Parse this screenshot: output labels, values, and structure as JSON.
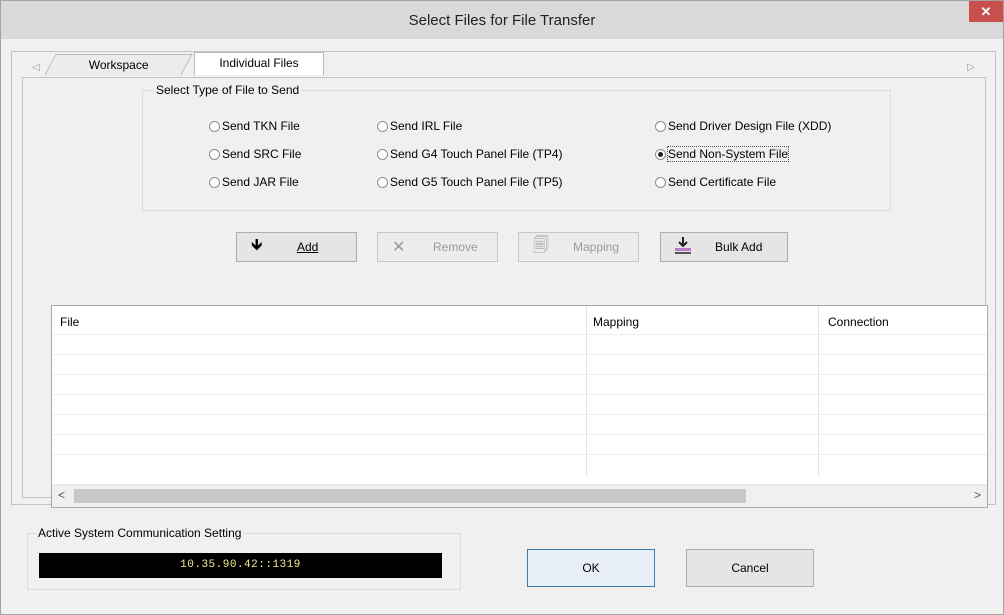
{
  "window": {
    "title": "Select Files for File Transfer",
    "close_label": "✕"
  },
  "tabs": [
    {
      "label": "Workspace"
    },
    {
      "label": "Individual Files"
    }
  ],
  "file_type_group": {
    "title": "Select Type of File to Send",
    "options": [
      {
        "label": "Send TKN File",
        "selected": false
      },
      {
        "label": "Send SRC File",
        "selected": false
      },
      {
        "label": "Send JAR File",
        "selected": false
      },
      {
        "label": "Send IRL File",
        "selected": false
      },
      {
        "label": "Send G4 Touch Panel File (TP4)",
        "selected": false
      },
      {
        "label": "Send G5 Touch Panel File (TP5)",
        "selected": false
      },
      {
        "label": "Send Driver Design File (XDD)",
        "selected": false
      },
      {
        "label": "Send Non-System File",
        "selected": true
      },
      {
        "label": "Send Certificate File",
        "selected": false
      }
    ]
  },
  "toolbar": {
    "add_label": "Add",
    "remove_label": "Remove",
    "mapping_label": "Mapping",
    "bulk_add_label": "Bulk Add"
  },
  "file_table": {
    "columns": [
      "File",
      "Mapping",
      "Connection"
    ],
    "rows": []
  },
  "status": {
    "label": "Active System Communication Setting",
    "value": "10.35.90.42::1319"
  },
  "dialog_buttons": {
    "ok_label": "OK",
    "cancel_label": "Cancel"
  }
}
